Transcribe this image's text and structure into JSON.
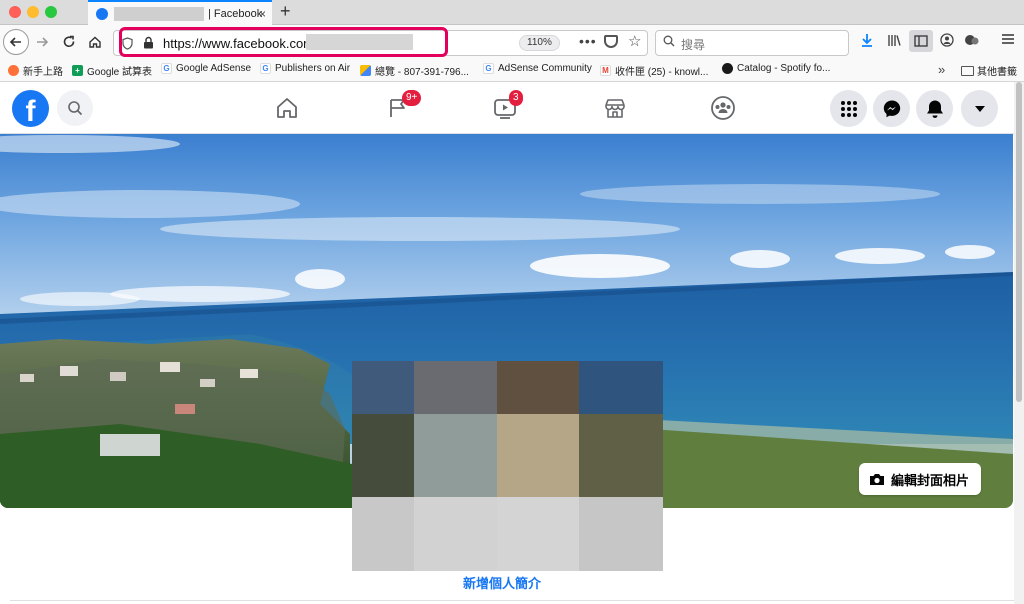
{
  "browser": {
    "tab": {
      "title": "| Facebook",
      "close_glyph": "×"
    },
    "new_tab_glyph": "+",
    "url": "https://www.facebook.com",
    "zoom": "110%",
    "page_actions_glyph": "•••",
    "search_placeholder": "搜尋",
    "bookmarks": [
      {
        "label": "新手上路",
        "icon": "firefox-icon",
        "color": "#ff7139"
      },
      {
        "label": "Google 試算表",
        "icon": "sheets-icon",
        "color": "#0f9d58"
      },
      {
        "label": "Google AdSense",
        "icon": "google-icon",
        "color": "#4285f4"
      },
      {
        "label": "Publishers on Air",
        "icon": "google-icon",
        "color": "#4285f4"
      },
      {
        "label": "總覽 - 807-391-796...",
        "icon": "google-ads-icon",
        "color": "#fbbc04"
      },
      {
        "label": "AdSense Community",
        "icon": "google-icon",
        "color": "#4285f4"
      },
      {
        "label": "收件匣 (25) - knowl...",
        "icon": "gmail-icon",
        "color": "#ea4335"
      },
      {
        "label": "Catalog - Spotify fo...",
        "icon": "spotify-icon",
        "color": "#1a1a1a"
      }
    ],
    "bookmarks_overflow_glyph": "»",
    "other_bookmarks": "其他書籤"
  },
  "facebook": {
    "logo_letter": "f",
    "nav": [
      {
        "name": "home",
        "icon": "home-icon"
      },
      {
        "name": "pages",
        "icon": "flag-icon",
        "badge": "9+"
      },
      {
        "name": "watch",
        "icon": "video-icon",
        "badge": "3"
      },
      {
        "name": "marketplace",
        "icon": "store-icon"
      },
      {
        "name": "groups",
        "icon": "groups-icon"
      }
    ],
    "accent": "#1877f2",
    "badge_color": "#e41e3f"
  },
  "profile": {
    "edit_cover_label": "編輯封面相片",
    "add_bio_label": "新增個人簡介",
    "avatar_pixel_colors": [
      "#3f5a7a",
      "#6a6b70",
      "#60503f",
      "#2f547e",
      "#464c3c",
      "#8f9c9a",
      "#b6a688",
      "#5f6046",
      "#c8c8c8",
      "#d2d2d2",
      "#d4d4d4",
      "#c6c6c6"
    ]
  }
}
